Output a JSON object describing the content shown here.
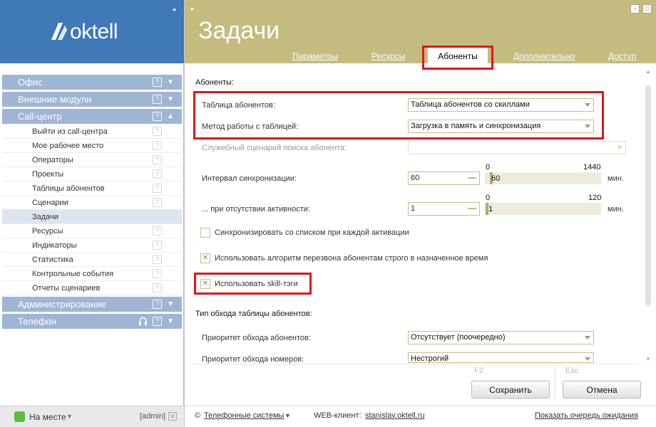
{
  "app": {
    "logo_text": "oktell"
  },
  "sidebar": {
    "collapse_glyph": "◂",
    "groups": [
      {
        "label": "Офис"
      },
      {
        "label": "Внешние модули"
      },
      {
        "label": "Call-центр"
      },
      {
        "label": "Администрирование"
      },
      {
        "label": "Телефон"
      }
    ],
    "items": [
      {
        "label": "Выйти из call-центра"
      },
      {
        "label": "Мое рабочее место"
      },
      {
        "label": "Операторы"
      },
      {
        "label": "Проекты"
      },
      {
        "label": "Таблицы абонентов"
      },
      {
        "label": "Сценарии"
      },
      {
        "label": "Задачи"
      },
      {
        "label": "Ресурсы"
      },
      {
        "label": "Индикаторы"
      },
      {
        "label": "Статистика"
      },
      {
        "label": "Контрольные события"
      },
      {
        "label": "Отчеты сценариев"
      }
    ],
    "help_glyph": "?",
    "collapse_arrow": "▼",
    "expand_arrow": "▲",
    "headset_icon": "headset-icon"
  },
  "status": {
    "label": "На месте",
    "dropdown": "▼",
    "user": "[admin]"
  },
  "header": {
    "title": "Задачи",
    "tabs": [
      "Параметры",
      "Ресурсы",
      "Абоненты",
      "Дополнительно",
      "Доступ"
    ],
    "minimize_glyph": "▫",
    "close_glyph": "□"
  },
  "form": {
    "section_title": "Абоненты:",
    "table_label": "Таблица абонентов:",
    "table_value": "Таблица абонентов со скиллами",
    "mode_label": "Метод работы с таблицей:",
    "mode_value": "Загрузка в память и синхронизация",
    "search_script_label": "Служебный сценарий поиска абонента:",
    "search_script_value": "",
    "sync_interval_label": "Интервал синхронизации:",
    "sync_interval_value": "60",
    "sync_slider_min": "0",
    "sync_slider_max": "1440",
    "sync_slider_value": "60",
    "sync_slider_fraction": 0.0417,
    "unit": "мин.",
    "inactive_label": "... при отсутствии активности:",
    "inactive_value": "1",
    "inactive_slider_min": "0",
    "inactive_slider_max": "120",
    "inactive_slider_value": "1",
    "inactive_slider_fraction": 0.0083,
    "sync_each_label": "Синхронизировать со списком при каждой активации",
    "sync_each_checked": false,
    "strict_redial_label": "Использовать алгоритм перезвона абонентам строго в назначенное время",
    "strict_redial_checked": true,
    "skill_tags_label": "Использовать skill-тэги",
    "skill_tags_checked": true,
    "check_glyph": "✕",
    "traverse_title": "Тип обхода таблицы абонентов:",
    "priority_label": "Приоритет обхода абонентов:",
    "priority_value": "Отсутствует (поочередно)",
    "numbers_label": "Приоритет обхода номеров:",
    "numbers_value": "Нестрогий"
  },
  "actions": {
    "save_hotkey": "F2",
    "save_label": "Сохранить",
    "cancel_hotkey": "Esc",
    "cancel_label": "Отмена"
  },
  "footer": {
    "copyright": "©",
    "company_link": "Телефонные системы",
    "company_dropdown": "▼",
    "web_client_label": "WEB-клиент:",
    "web_client_link": "stanislav.oktell.ru",
    "queue_link": "Показать очередь ожидания"
  }
}
